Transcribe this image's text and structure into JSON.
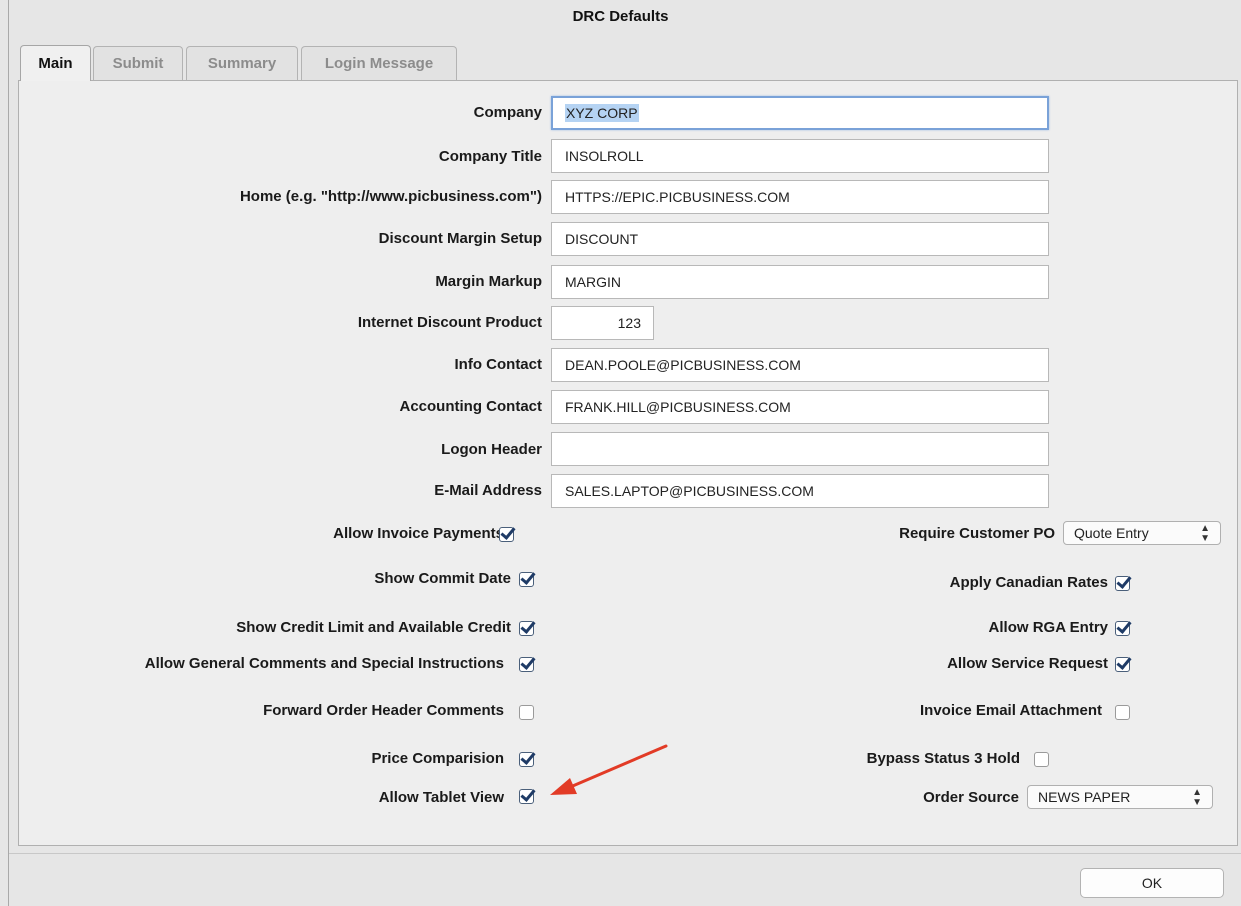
{
  "window": {
    "title": "DRC Defaults"
  },
  "tabs": [
    {
      "label": "Main",
      "active": true
    },
    {
      "label": "Submit",
      "active": false
    },
    {
      "label": "Summary",
      "active": false
    },
    {
      "label": "Login Message",
      "active": false
    }
  ],
  "fields": [
    {
      "label": "Company",
      "value": "XYZ CORP"
    },
    {
      "label": "Company Title",
      "value": "INSOLROLL"
    },
    {
      "label": "Home (e.g. \"http://www.picbusiness.com\")",
      "value": "HTTPS://EPIC.PICBUSINESS.COM"
    },
    {
      "label": "Discount Margin Setup",
      "value": "DISCOUNT"
    },
    {
      "label": "Margin Markup",
      "value": "MARGIN"
    },
    {
      "label": "Internet Discount Product",
      "value": "123"
    },
    {
      "label": "Info Contact",
      "value": "DEAN.POOLE@PICBUSINESS.COM"
    },
    {
      "label": "Accounting Contact",
      "value": "FRANK.HILL@PICBUSINESS.COM"
    },
    {
      "label": "Logon Header",
      "value": ""
    },
    {
      "label": "E-Mail Address",
      "value": "SALES.LAPTOP@PICBUSINESS.COM"
    }
  ],
  "left_options": [
    {
      "label": "Allow Invoice Payments",
      "checked": true
    },
    {
      "label": "Show Commit Date",
      "checked": true
    },
    {
      "label": "Show Credit Limit and Available Credit",
      "checked": true
    },
    {
      "label": "Allow General Comments and Special Instructions",
      "checked": true
    },
    {
      "label": "Forward Order Header Comments",
      "checked": false
    },
    {
      "label": "Price Comparision",
      "checked": true
    },
    {
      "label": "Allow Tablet View",
      "checked": true
    }
  ],
  "right_options": {
    "require_customer_po": {
      "label": "Require Customer PO",
      "value": "Quote Entry"
    },
    "apply_canadian_rates": {
      "label": "Apply Canadian Rates",
      "checked": true
    },
    "allow_rga_entry": {
      "label": "Allow RGA Entry",
      "checked": true
    },
    "allow_service_request": {
      "label": "Allow Service Request",
      "checked": true
    },
    "invoice_email_attachment": {
      "label": "Invoice Email Attachment",
      "checked": false
    },
    "bypass_status_3_hold": {
      "label": "Bypass Status 3 Hold",
      "checked": false
    },
    "order_source": {
      "label": "Order Source",
      "value": "NEWS PAPER"
    }
  },
  "buttons": {
    "ok": "OK"
  },
  "colors": {
    "annotation_arrow": "#e23b26",
    "focus_ring": "#7aa2d8",
    "selection": "#b5d3f3"
  },
  "icons": {
    "select_arrows": "⌃⌄",
    "annotation": "red-arrow-icon"
  }
}
